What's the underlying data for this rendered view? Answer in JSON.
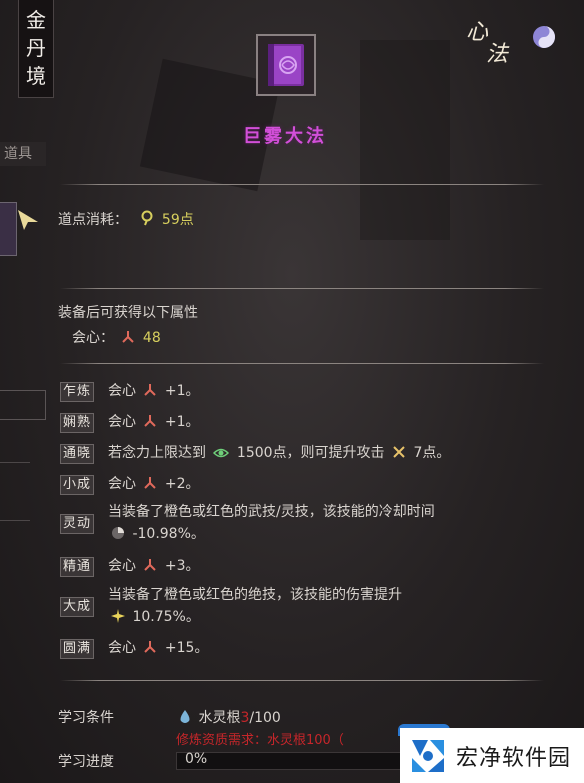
{
  "realm_label": "金丹境",
  "realm_chars": [
    "金",
    "丹",
    "境"
  ],
  "xinfa_label": "心法",
  "xinfa_chars": [
    "心",
    "法"
  ],
  "skill": {
    "name": "巨雾大法",
    "icon": "purple-book-icon"
  },
  "side": {
    "tab_label": "道具"
  },
  "cost": {
    "label": "道点消耗：",
    "value": "59点"
  },
  "attributes": {
    "header": "装备后可获得以下属性",
    "items": [
      {
        "label": "会心：",
        "value": "48"
      }
    ]
  },
  "stages": [
    {
      "tag": "乍炼",
      "line1_pre": "会心",
      "line1_post": "+1。"
    },
    {
      "tag": "娴熟",
      "line1_pre": "会心",
      "line1_post": "+1。"
    },
    {
      "tag": "通晓",
      "line1_pre": "若念力上限达到",
      "mid_value": "1500点，则可提升攻击",
      "line1_post": "7点。"
    },
    {
      "tag": "小成",
      "line1_pre": "会心",
      "line1_post": "+2。"
    },
    {
      "tag": "灵动",
      "line1_pre": "当装备了橙色或红色的武技/灵技，该技能的冷却时间",
      "line2": "-10.98%。"
    },
    {
      "tag": "精通",
      "line1_pre": "会心",
      "line1_post": "+3。"
    },
    {
      "tag": "大成",
      "line1_pre": "当装备了橙色或红色的绝技，该技能的伤害提升",
      "line2": "10.75%。"
    },
    {
      "tag": "圆满",
      "line1_pre": "会心",
      "line1_post": "+15。"
    }
  ],
  "learn": {
    "condition_label": "学习条件",
    "requirement_name": "水灵根",
    "requirement_current": "3",
    "requirement_total": "/100",
    "warning": "修炼资质需求：水灵根100（",
    "progress_label": "学习进度",
    "progress_text": "0%",
    "progress_value": 0
  },
  "watermark": {
    "text": "宏净软件园"
  },
  "colors": {
    "title": "#d24fd8",
    "value_yellow": "#d7cf5e",
    "purple": "#c34ce0",
    "warning_red": "#c5262a"
  }
}
